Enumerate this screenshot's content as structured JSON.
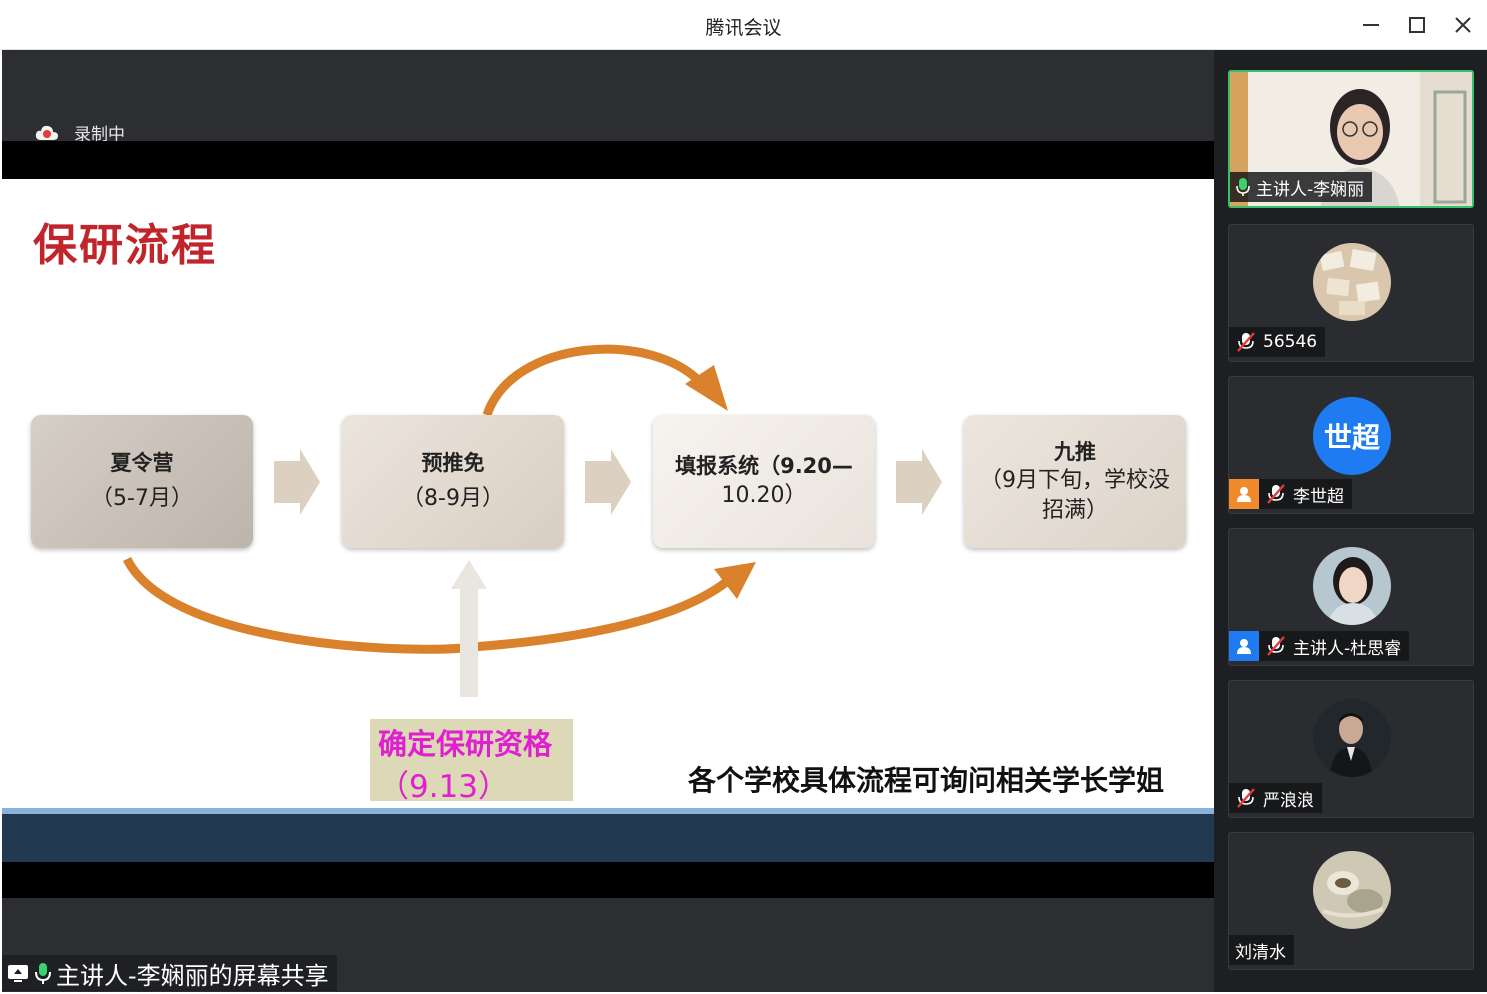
{
  "window": {
    "title": "腾讯会议",
    "controls": [
      "minimize-icon",
      "maximize-icon",
      "close-icon"
    ]
  },
  "recording": {
    "label": "录制中"
  },
  "slide": {
    "title": "保研流程",
    "steps": [
      {
        "name": "夏令营",
        "period": "（5-7月）"
      },
      {
        "name": "预推免",
        "period": "（8-9月）"
      },
      {
        "name": "填报系统（9.20—",
        "period": "10.20）"
      },
      {
        "name": "九推",
        "period": "（9月下旬，学校没招满）"
      }
    ],
    "qualification": {
      "title": "确定保研资格",
      "date": "（9.13）"
    },
    "note": "各个学校具体流程可询问相关学长学姐",
    "colors": {
      "title": "#c0252b",
      "arrow": "#d9822b",
      "qualification_text": "#e020d0",
      "footer_bar": "#213a52"
    }
  },
  "share": {
    "label": "主讲人-李娴丽的屏幕共享"
  },
  "participants": [
    {
      "name": "主讲人-李娴丽",
      "status": "mic-on",
      "video": true,
      "active": true
    },
    {
      "name": "56546",
      "status": "mic-muted",
      "video": false
    },
    {
      "name": "李世超",
      "status": "mic-muted",
      "video": false,
      "avatar_text": "世超",
      "badge": "orange-user"
    },
    {
      "name": "主讲人-杜思睿",
      "status": "mic-muted",
      "video": false,
      "badge": "blue-user"
    },
    {
      "name": "严浪浪",
      "status": "mic-muted",
      "video": false
    },
    {
      "name": "刘清水",
      "status": "none",
      "video": false
    }
  ]
}
